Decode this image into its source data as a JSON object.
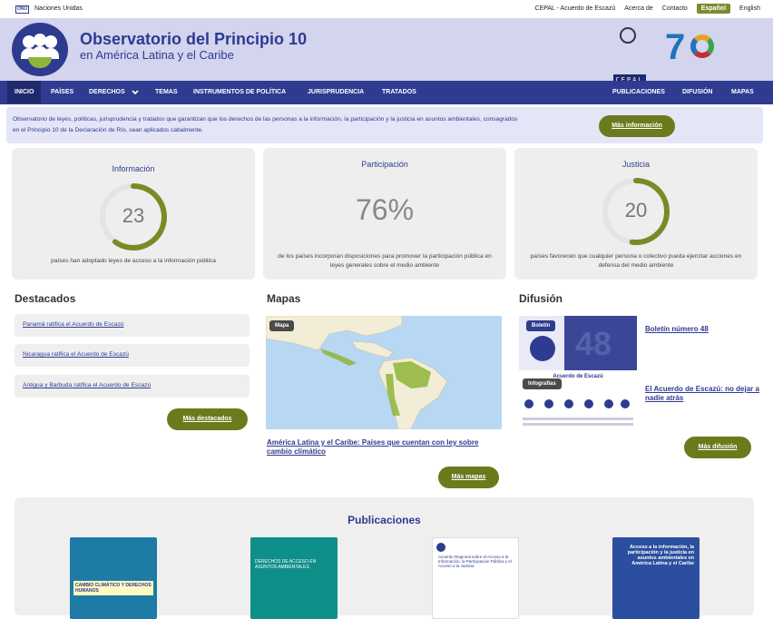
{
  "topbar": {
    "un_logo": "ONU",
    "un_label": "Naciones Unidas",
    "links": [
      "CEPAL - Acuerdo de Escazú",
      "Acerca de",
      "Contacto"
    ],
    "lang_active": "Español",
    "lang_other": "English"
  },
  "header": {
    "title": "Observatorio del Principio 10",
    "subtitle": "en América Latina y el Caribe",
    "cepal_logo": "CEPAL"
  },
  "nav": {
    "left": [
      "INICIO",
      "PAÍSES",
      "DERECHOS",
      "TEMAS",
      "INSTRUMENTOS DE POLÍTICA",
      "JURISPRUDENCIA",
      "TRATADOS"
    ],
    "right": [
      "PUBLICACIONES",
      "DIFUSIÓN",
      "MAPAS"
    ],
    "active": "INICIO",
    "dropdown_icon": "chevron-down-icon"
  },
  "intro": {
    "text": "Observatorio de leyes, políticas, jurisprudencia y tratados que garantizan que los derechos de las personas a la información, la participación y la justicia en asuntos ambientales, consagrados en el Principio 10 de la Declaración de Río, sean aplicados cabalmente.",
    "button": "Más información"
  },
  "stats": {
    "info": {
      "label": "Información",
      "value": "23",
      "ring_fraction": 0.6,
      "desc": "países han adoptado leyes de acceso a la información pública"
    },
    "part": {
      "label": "Participación",
      "value": "76%",
      "desc": "de los países incorporan disposiciones para promover la participación pública en leyes generales sobre el medio ambiente"
    },
    "just": {
      "label": "Justicia",
      "value": "20",
      "ring_fraction": 0.52,
      "desc": "países favorecen que cualquier persona o colectivo pueda ejercitar acciones en defensa del medio ambiente"
    },
    "ring_color": "#7a8a25"
  },
  "destacados": {
    "title": "Destacados",
    "items": [
      "Panamá ratifica el Acuerdo de Escazú",
      "Nicaragua ratifica el Acuerdo de Escazú",
      "Antigua y Barbuda ratifica el Acuerdo de Escazú"
    ],
    "button": "Más destacados"
  },
  "mapas": {
    "title": "Mapas",
    "tag": "Mapa",
    "link": "América Latina y el Caribe: Países que cuentan con ley sobre cambio climático",
    "button": "Más mapas"
  },
  "difusion": {
    "title": "Difusión",
    "boletin_tag": "Boletín",
    "boletin_number": "48",
    "boletin_link": "Boletín número 48",
    "info_tag": "Infografías",
    "info_heading": "Acuerdo de Escazú",
    "info_link": "El Acuerdo de Escazú: no dejar a nadie atrás",
    "button": "Más difusión"
  },
  "publicaciones": {
    "title": "Publicaciones",
    "covers": [
      {
        "text": "CAMBIO CLIMÁTICO Y DERECHOS HUMANOS",
        "bg": "#1d7ba6"
      },
      {
        "text": "DERECHOS DE ACCESO EN ASUNTOS AMBIENTALES",
        "bg": "#0e8f8a"
      },
      {
        "text": "Acuerdo Regional sobre el Acceso a la Información, la Participación Pública y el Acceso a la Justicia",
        "bg": "#ffffff"
      },
      {
        "text": "Acceso a la información, la participación y la justicia en asuntos ambientales en América Latina y el Caribe",
        "bg": "#2b4f9e"
      }
    ]
  }
}
